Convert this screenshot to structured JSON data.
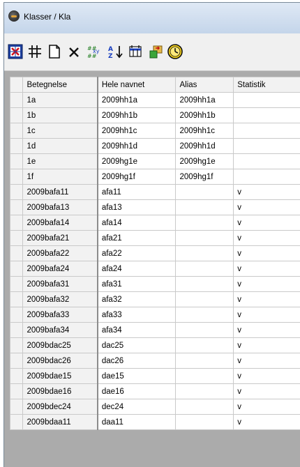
{
  "window": {
    "title": "Klasser / Kla"
  },
  "toolbar": {
    "buttons": [
      {
        "icon": "grid-select-icon"
      },
      {
        "icon": "hash-grid-icon"
      },
      {
        "icon": "new-document-icon"
      },
      {
        "icon": "delete-icon"
      },
      {
        "icon": "merge-icon"
      },
      {
        "icon": "sort-az-icon"
      },
      {
        "icon": "columns-icon"
      },
      {
        "icon": "import-icon"
      },
      {
        "icon": "clock-icon"
      }
    ]
  },
  "grid": {
    "columns": [
      "Betegnelse",
      "Hele navnet",
      "Alias",
      "Statistik"
    ],
    "rows": [
      [
        "1a",
        "2009hh1a",
        "2009hh1a",
        ""
      ],
      [
        "1b",
        "2009hh1b",
        "2009hh1b",
        ""
      ],
      [
        "1c",
        "2009hh1c",
        "2009hh1c",
        ""
      ],
      [
        "1d",
        "2009hh1d",
        "2009hh1d",
        ""
      ],
      [
        "1e",
        "2009hg1e",
        "2009hg1e",
        ""
      ],
      [
        "1f",
        "2009hg1f",
        "2009hg1f",
        ""
      ],
      [
        "2009bafa11",
        "afa11",
        "",
        "v"
      ],
      [
        "2009bafa13",
        "afa13",
        "",
        "v"
      ],
      [
        "2009bafa14",
        "afa14",
        "",
        "v"
      ],
      [
        "2009bafa21",
        "afa21",
        "",
        "v"
      ],
      [
        "2009bafa22",
        "afa22",
        "",
        "v"
      ],
      [
        "2009bafa24",
        "afa24",
        "",
        "v"
      ],
      [
        "2009bafa31",
        "afa31",
        "",
        "v"
      ],
      [
        "2009bafa32",
        "afa32",
        "",
        "v"
      ],
      [
        "2009bafa33",
        "afa33",
        "",
        "v"
      ],
      [
        "2009bafa34",
        "afa34",
        "",
        "v"
      ],
      [
        "2009bdac25",
        "dac25",
        "",
        "v"
      ],
      [
        "2009bdac26",
        "dac26",
        "",
        "v"
      ],
      [
        "2009bdae15",
        "dae15",
        "",
        "v"
      ],
      [
        "2009bdae16",
        "dae16",
        "",
        "v"
      ],
      [
        "2009bdec24",
        "dec24",
        "",
        "v"
      ],
      [
        "2009bdaa11",
        "daa11",
        "",
        "v"
      ]
    ]
  }
}
